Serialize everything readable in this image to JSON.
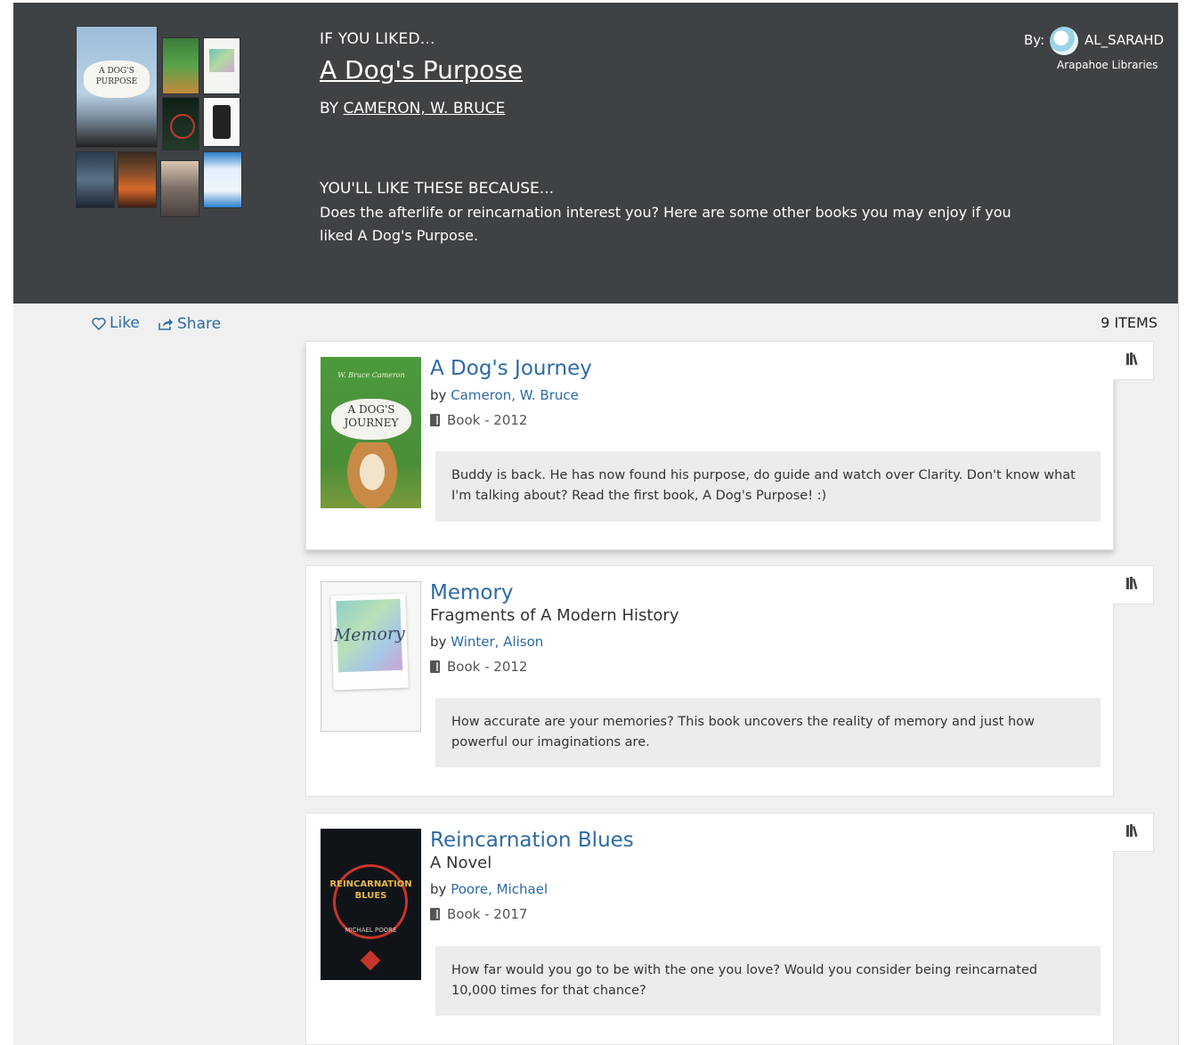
{
  "header": {
    "if_liked": "IF YOU LIKED...",
    "book_title": "A Dog's Purpose",
    "by_prefix": "BY",
    "book_author": "CAMERON, W. BRUCE",
    "because_heading": "YOU'LL LIKE THESE BECAUSE...",
    "because_text": "Does the afterlife or reincarnation interest you? Here are some other books you may enjoy if you liked A Dog's Purpose.",
    "by_label": "By:",
    "username": "AL_SARAHD",
    "library": "Arapahoe Libraries",
    "main_cover_caption": "A DOG'S PURPOSE"
  },
  "toolbar": {
    "like_label": "Like",
    "share_label": "Share",
    "items_count": "9 ITEMS"
  },
  "items": [
    {
      "title": "A Dog's Journey",
      "by": "by",
      "author": "Cameron, W. Bruce",
      "format": "Book - 2012",
      "note": "Buddy is back. He has now found his purpose, do guide and watch over Clarity. Don't know what I'm talking about? Read the first book, A Dog's Purpose! :)",
      "cover_text": "A DOG'S JOURNEY",
      "cover_author": "W. Bruce Cameron"
    },
    {
      "title": "Memory",
      "subtitle": "Fragments of A Modern History",
      "by": "by",
      "author": "Winter, Alison",
      "format": "Book - 2012",
      "note": "How accurate are your memories? This book uncovers the reality of memory and just how powerful our imaginations are.",
      "cover_text": "Memory"
    },
    {
      "title": "Reincarnation Blues",
      "subtitle": "A Novel",
      "by": "by",
      "author": "Poore, Michael",
      "format": "Book - 2017",
      "note": "How far would you go to be with the one you love? Would you consider being reincarnated 10,000 times for that chance?",
      "cover_text": "REINCARNATION BLUES",
      "cover_author": "MICHAEL POORE"
    }
  ],
  "colors": {
    "header_bg": "#3f4245",
    "link": "#2e6aa6",
    "page_bg": "#f0f0f0"
  },
  "icons": [
    "heart-icon",
    "share-icon",
    "book-icon",
    "shelf-icon"
  ]
}
